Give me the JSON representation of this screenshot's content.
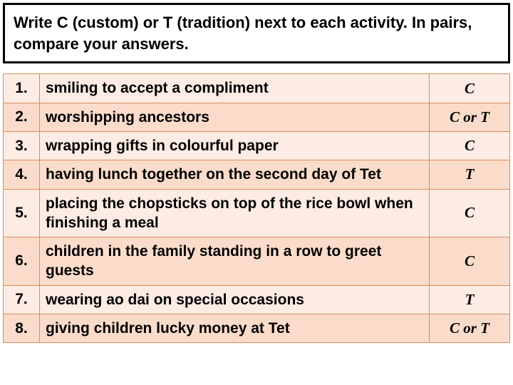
{
  "instruction": "Write C (custom) or T (tradition) next to each activity. In pairs, compare your answers.",
  "rows": [
    {
      "num": "1.",
      "activity": "smiling to accept a compliment",
      "answer": "C"
    },
    {
      "num": "2.",
      "activity": "worshipping ancestors",
      "answer": "C or T"
    },
    {
      "num": "3.",
      "activity": "wrapping gifts in colourful paper",
      "answer": "C"
    },
    {
      "num": "4.",
      "activity": "having lunch together on the second day of Tet",
      "answer": "T"
    },
    {
      "num": "5.",
      "activity": "placing the chopsticks on top of the rice bowl when finishing a meal",
      "answer": "C"
    },
    {
      "num": "6.",
      "activity": "children in the family standing in a row to greet guests",
      "answer": "C"
    },
    {
      "num": "7.",
      "activity": "wearing ao dai on special occasions",
      "answer": "T"
    },
    {
      "num": "8.",
      "activity": "giving children lucky money at Tet",
      "answer": "C or T"
    }
  ]
}
